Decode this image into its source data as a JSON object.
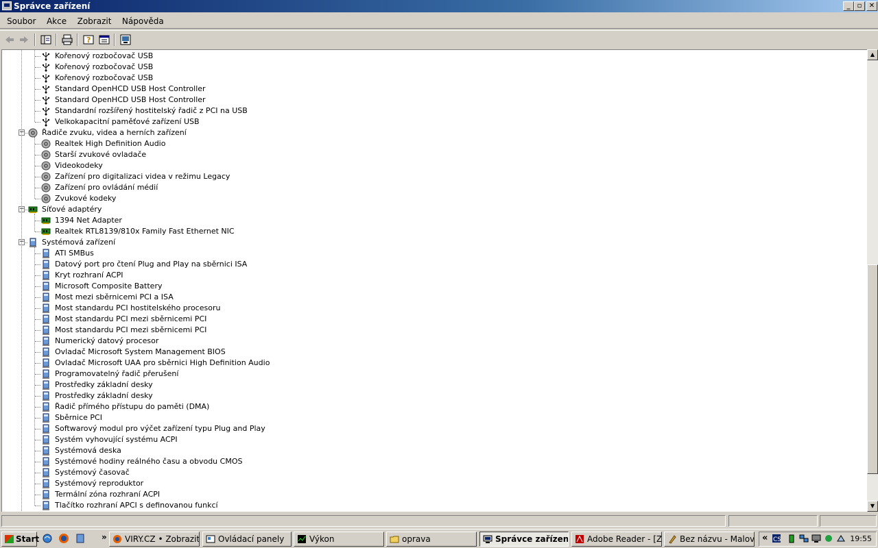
{
  "window": {
    "title": "Správce zařízení",
    "controls": [
      "minimize",
      "maximize",
      "close"
    ]
  },
  "menu": [
    "Soubor",
    "Akce",
    "Zobrazit",
    "Nápověda"
  ],
  "toolbar_icons": [
    "back-icon",
    "forward-icon",
    "console-tree-icon",
    "print-icon",
    "help-icon",
    "properties-icon",
    "scan-hardware-icon"
  ],
  "tree": {
    "usb_items": [
      "Kořenový rozbočovač USB",
      "Kořenový rozbočovač USB",
      "Kořenový rozbočovač USB",
      "Standard OpenHCD USB Host Controller",
      "Standard OpenHCD USB Host Controller",
      "Standardní rozšířený hostitelský řadič z PCI na USB",
      "Velkokapacitní paměťové zařízení USB"
    ],
    "sound": {
      "label": "Řadiče zvuku, videa a herních zařízení",
      "items": [
        "Realtek High Definition Audio",
        "Starší zvukové ovladače",
        "Videokodeky",
        "Zařízení pro digitalizaci videa v režimu Legacy",
        "Zařízení pro ovládání médií",
        "Zvukové kodeky"
      ]
    },
    "network": {
      "label": "Síťové adaptéry",
      "items": [
        "1394 Net Adapter",
        "Realtek RTL8139/810x Family Fast Ethernet NIC"
      ]
    },
    "system": {
      "label": "Systémová zařízení",
      "items": [
        "ATI SMBus",
        "Datový port pro čtení Plug and Play na sběrnici ISA",
        "Kryt rozhraní ACPI",
        "Microsoft Composite Battery",
        "Most mezi sběrnicemi PCI a ISA",
        "Most standardu PCI hostitelského procesoru",
        "Most standardu PCI mezi sběrnicemi PCI",
        "Most standardu PCI mezi sběrnicemi PCI",
        "Numerický datový procesor",
        "Ovladač Microsoft System Management BIOS",
        "Ovladač Microsoft UAA pro sběrnici High Definition Audio",
        "Programovatelný řadič přerušení",
        "Prostředky základní desky",
        "Prostředky základní desky",
        "Řadič přímého přístupu do paměti (DMA)",
        "Sběrnice PCI",
        "Softwarový modul pro výčet zařízení typu Plug and Play",
        "Systém vyhovující systému ACPI",
        "Systémová deska",
        "Systémové hodiny reálného času a obvodu CMOS",
        "Systémový časovač",
        "Systémový reproduktor",
        "Termální zóna rozhraní ACPI",
        "Tlačítko rozhraní APCI s definovanou funkcí"
      ]
    }
  },
  "taskbar": {
    "start_label": "Start",
    "quicklaunch_chevron": "»",
    "tasks": [
      {
        "label": "VIRY.CZ • Zobrazit...",
        "icon": "firefox-icon",
        "active": false
      },
      {
        "label": "Ovládací panely",
        "icon": "control-panel-icon",
        "active": false
      },
      {
        "label": "Výkon",
        "icon": "performance-icon",
        "active": false
      },
      {
        "label": "oprava",
        "icon": "folder-icon",
        "active": false
      },
      {
        "label": "Správce zařízení",
        "icon": "device-manager-icon",
        "active": true
      },
      {
        "label": "Adobe Reader - [Z...",
        "icon": "adobe-reader-icon",
        "active": false
      },
      {
        "label": "Bez názvu - Malování",
        "icon": "paint-icon",
        "active": false
      }
    ],
    "tray_chevron": "«",
    "clock": "19:55"
  }
}
